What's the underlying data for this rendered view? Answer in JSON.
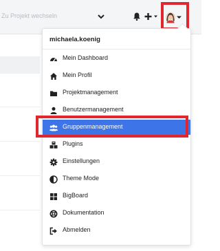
{
  "header": {
    "project_placeholder": "Zu Projekt wechseln",
    "icons": [
      "chevron-down-icon",
      "bell-icon",
      "plus-icon",
      "avatar"
    ]
  },
  "user_menu": {
    "username": "michaela.koenig",
    "items": [
      {
        "label": "Mein Dashboard",
        "icon": "dashboard-icon"
      },
      {
        "label": "Mein Profil",
        "icon": "home-icon"
      },
      {
        "label": "Projektmanagement",
        "icon": "folder-icon"
      },
      {
        "label": "Benutzermanagement",
        "icon": "user-icon"
      },
      {
        "label": "Gruppenmanagement",
        "icon": "group-icon",
        "active": true
      },
      {
        "label": "Plugins",
        "icon": "cubes-icon"
      },
      {
        "label": "Einstellungen",
        "icon": "gear-icon"
      },
      {
        "label": "Theme Mode",
        "icon": "contrast-icon"
      },
      {
        "label": "BigBoard",
        "icon": "grid-icon"
      },
      {
        "label": "Dokumentation",
        "icon": "lifebuoy-icon"
      },
      {
        "label": "Abmelden",
        "icon": "logout-icon"
      }
    ]
  },
  "colors": {
    "active_bg": "#3d74e8",
    "highlight": "#e0262e",
    "icon": "#222222"
  }
}
